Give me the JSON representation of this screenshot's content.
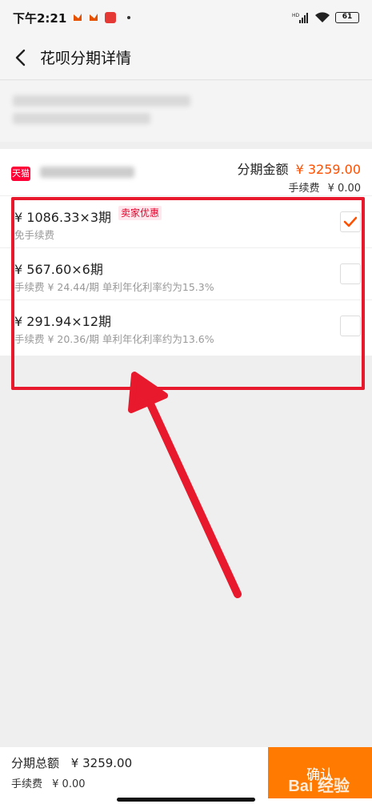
{
  "status_bar": {
    "time": "下午2:21",
    "battery": "61",
    "network": "HD"
  },
  "header": {
    "title": "花呗分期详情"
  },
  "shop": {
    "badge": "天猫",
    "amount_label": "分期金额",
    "amount_value": "¥ 3259.00",
    "fee_label": "手续费",
    "fee_value": "¥ 0.00"
  },
  "options": [
    {
      "main": "¥ 1086.33×3期",
      "sub": "免手续费",
      "tag": "卖家优惠",
      "checked": true
    },
    {
      "main": "¥ 567.60×6期",
      "sub": "手续费 ¥ 24.44/期 单利年化利率约为15.3%",
      "checked": false
    },
    {
      "main": "¥ 291.94×12期",
      "sub": "手续费 ¥ 20.36/期 单利年化利率约为13.6%",
      "checked": false
    }
  ],
  "footer": {
    "total_label": "分期总额",
    "total_value": "¥ 3259.00",
    "fee_label": "手续费",
    "fee_value": "¥ 0.00",
    "confirm_label": "确认",
    "watermark": "Bai 经验"
  },
  "colors": {
    "accent": "#ff5000",
    "annotation": "#e8192c",
    "tmall": "#ff0036"
  }
}
